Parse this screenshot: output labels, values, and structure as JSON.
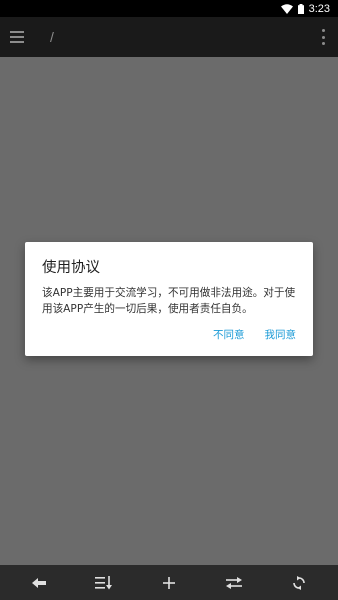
{
  "status_bar": {
    "time": "3:23",
    "icons": [
      "wifi-icon",
      "battery-icon"
    ]
  },
  "app_bar": {
    "path": "/",
    "menu_icon": "hamburger-menu-icon",
    "overflow_icon": "more-vert-icon"
  },
  "dialog": {
    "title": "使用协议",
    "message": "该APP主要用于交流学习，不可用做非法用途。对于使用该APP产生的一切后果，使用者责任自负。",
    "disagree_label": "不同意",
    "agree_label": "我同意",
    "accent_color": "#1a9ad6"
  },
  "bottom_bar": {
    "buttons": [
      {
        "name": "back",
        "icon": "arrow-left-icon"
      },
      {
        "name": "sort",
        "icon": "sort-icon"
      },
      {
        "name": "add",
        "icon": "plus-icon"
      },
      {
        "name": "swap",
        "icon": "swap-icon"
      },
      {
        "name": "refresh",
        "icon": "refresh-icon"
      }
    ]
  },
  "colors": {
    "background_dim": "#6b6b6b",
    "app_bar": "#1a1a1a",
    "bottom_bar": "#2b2b2b"
  }
}
